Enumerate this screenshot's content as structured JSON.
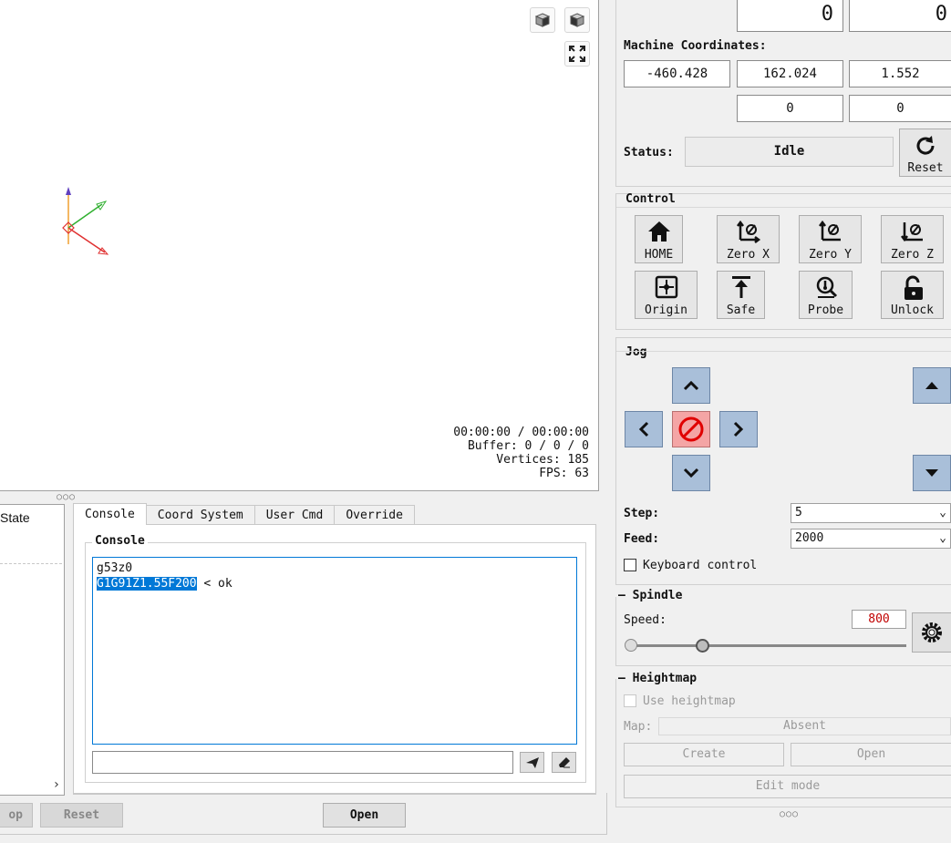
{
  "viewport": {
    "view_buttons": [
      {
        "icon": "cube-front-icon"
      },
      {
        "icon": "cube-iso-icon"
      },
      {
        "icon": "fit-view-icon"
      }
    ],
    "stats": {
      "time": "00:00:00 / 00:00:00",
      "buffer": "Buffer: 0 / 0 / 0",
      "vertices": "Vertices: 185",
      "fps": "FPS: 63"
    }
  },
  "left_panel": {
    "state_label": "State"
  },
  "tabs": [
    {
      "label": "Console"
    },
    {
      "label": "Coord System"
    },
    {
      "label": "User Cmd"
    },
    {
      "label": "Override"
    }
  ],
  "console": {
    "group_title": "Console",
    "lines": [
      {
        "text": "g53z0"
      },
      {
        "command": "G1G91Z1.55F200",
        "response": " < ok"
      }
    ],
    "input_value": "",
    "send_icon": "send-icon",
    "clear_icon": "eraser-icon"
  },
  "bottom_buttons": {
    "stop": "op",
    "reset": "Reset",
    "open": "Open"
  },
  "coordinates": {
    "work_row": [
      "0",
      "0"
    ],
    "machine_label": "Machine Coordinates:",
    "machine": [
      "-460.428",
      "162.024",
      "1.552"
    ],
    "machine_row2": [
      "0",
      "0"
    ],
    "status_label": "Status:",
    "status_value": "Idle",
    "reset_label": "Reset"
  },
  "control": {
    "title": "Control",
    "buttons": [
      {
        "label": "HOME",
        "icon": "home-icon"
      },
      {
        "label": "Zero X",
        "icon": "zero-x-icon"
      },
      {
        "label": "Zero Y",
        "icon": "zero-y-icon"
      },
      {
        "label": "Zero Z",
        "icon": "zero-z-icon"
      },
      {
        "label": "Origin",
        "icon": "origin-icon"
      },
      {
        "label": "Safe",
        "icon": "safe-icon"
      },
      {
        "label": "Probe",
        "icon": "probe-icon"
      },
      {
        "label": "Unlock",
        "icon": "unlock-icon"
      }
    ]
  },
  "jog": {
    "title": "Jog",
    "step_label": "Step:",
    "step_value": "5",
    "feed_label": "Feed:",
    "feed_value": "2000",
    "keyboard_label": "Keyboard control",
    "keyboard_checked": false
  },
  "spindle": {
    "title": "Spindle",
    "speed_label": "Speed:",
    "speed_value": "800",
    "slider_position": 0.25
  },
  "heightmap": {
    "title": "Heightmap",
    "use_label": "Use heightmap",
    "map_label": "Map:",
    "map_value": "Absent",
    "create_label": "Create",
    "open_label": "Open",
    "edit_label": "Edit mode"
  },
  "colors": {
    "jog_blue": "#a9bfd9",
    "stop_red": "#f4a5a5",
    "speed_text": "#c00000",
    "selection": "#0078d7"
  }
}
